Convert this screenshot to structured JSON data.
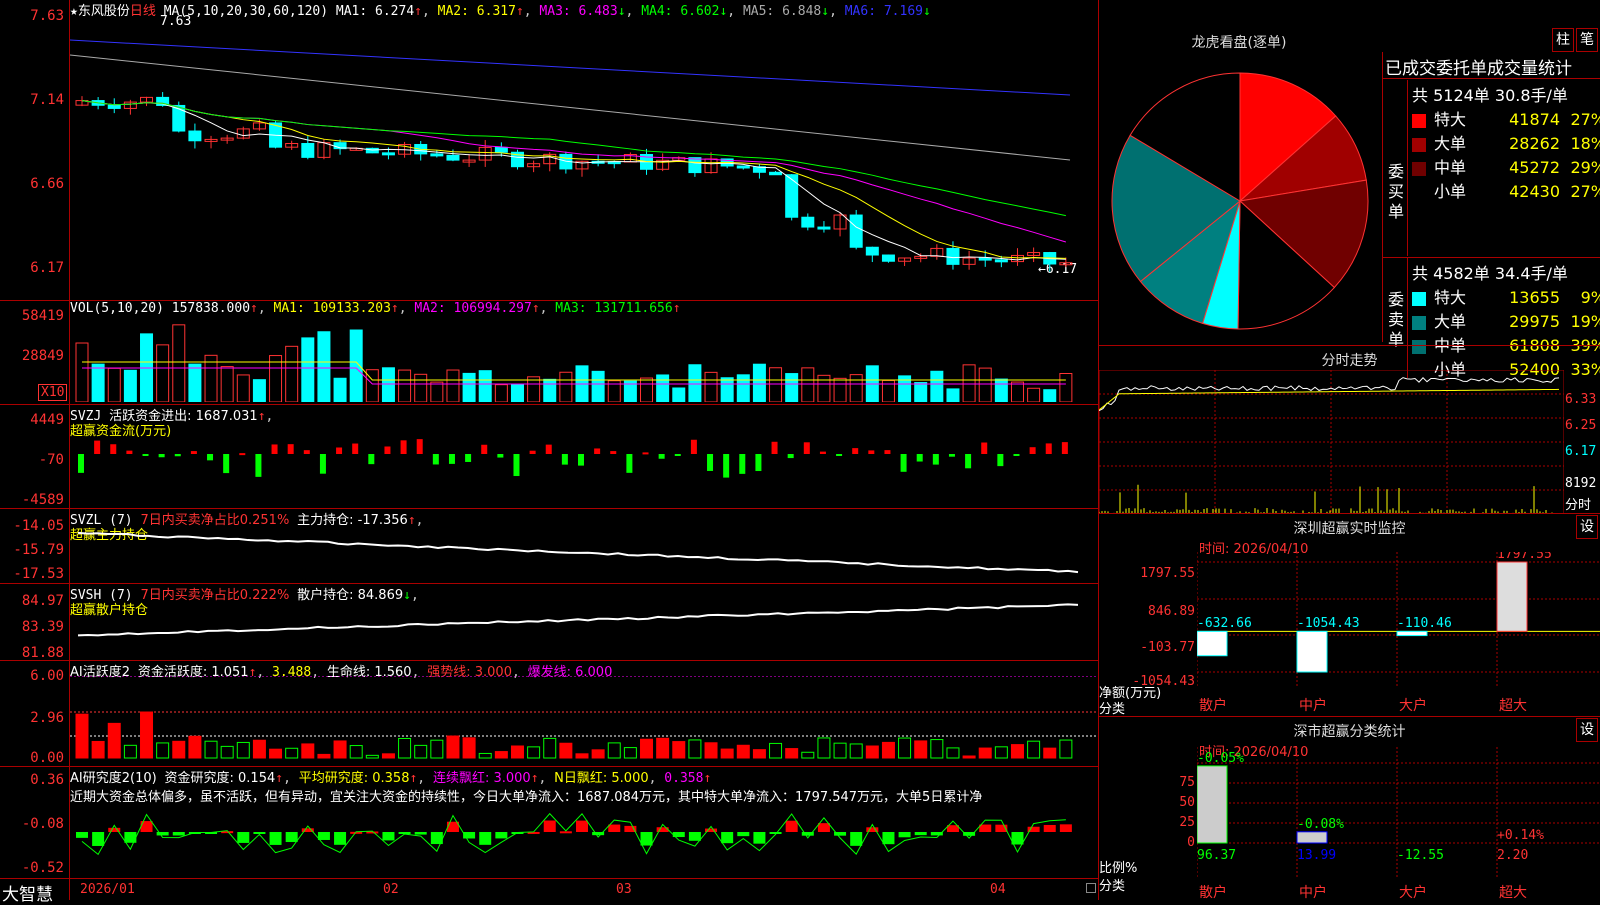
{
  "chart": {
    "title": "东风股份",
    "period": "日线",
    "ma_header": {
      "label": "MA(5,10,20,30,60,120)",
      "ma1": "MA1: 6.274",
      "ma2": "MA2: 6.317",
      "ma3": "MA3: 6.483",
      "ma4": "MA4: 6.602",
      "ma5": "MA5: 6.848",
      "ma6": "MA6: 7.169"
    },
    "y_labels": [
      "7.63",
      "7.14",
      "6.66",
      "6.17"
    ],
    "high_mark": "7.63",
    "low_mark": "←6.17",
    "colors": {
      "up": "#ff3333",
      "down": "#00ffff",
      "ma1": "#ffffff",
      "ma2": "#ffff00",
      "ma3": "#ff00ff",
      "ma4": "#00ff00",
      "ma5": "#aaaaaa",
      "ma6": "#3333ff"
    }
  },
  "vol": {
    "header": "VOL(5,10,20)",
    "value": "157838.000",
    "ma1": "MA1: 109133.203",
    "ma2": "MA2: 106994.297",
    "ma3": "MA3: 131711.656",
    "y_labels": [
      "58419",
      "28849"
    ],
    "unit": "X10"
  },
  "svzj": {
    "header": "SVZJ",
    "label": "活跃资金进出: 1687.031",
    "subtitle": "超赢资金流(万元)",
    "y_labels": [
      "4449",
      "-70",
      "-4589"
    ]
  },
  "svzl": {
    "header": "SVZL (7)",
    "label1": "7日内买卖净占比0.251%",
    "label2": "主力持仓: -17.356",
    "subtitle": "超赢主力持仓",
    "y_labels": [
      "-14.05",
      "-15.79",
      "-17.53"
    ]
  },
  "svsh": {
    "header": "SVSH (7)",
    "label1": "7日内买卖净占比0.222%",
    "label2": "散户持仓: 84.869",
    "subtitle": "超赢散户持仓",
    "y_labels": [
      "84.97",
      "83.39",
      "81.88"
    ]
  },
  "ai_active": {
    "header": "AI活跃度2",
    "a": "资金活跃度: 1.051",
    "b": "3.488",
    "c": "生命线: 1.560",
    "d": "强势线: 3.000",
    "e": "爆发线: 6.000",
    "y_labels": [
      "6.00",
      "2.96",
      "0.00"
    ]
  },
  "ai_research": {
    "header": "AI研究度2(10)",
    "a": "资金研究度: 0.154",
    "b": "平均研究度: 0.358",
    "c": "连续飘红: 3.000",
    "d": "N日飘红: 5.000",
    "e": "0.358",
    "comment": "近期大资金总体偏多，虽不活跃，但有异动，宜关注大资金的持续性，今日大单净流入：1687.084万元，其中特大单净流入：1797.547万元，大单5日累计净",
    "y_labels": [
      "0.36",
      "-0.08",
      "-0.52"
    ]
  },
  "xaxis": {
    "brand": "大智慧",
    "labels": [
      "2026/01",
      "02",
      "03",
      "04"
    ]
  },
  "dragon": {
    "title": "龙虎看盘(逐单)",
    "btn1": "柱",
    "btn2": "笔",
    "stat_title": "已成交委托单成交量统计",
    "buy_label": "委买单",
    "sell_label": "委卖单",
    "buy_total": "共 5124单 30.8手/单",
    "sell_total": "共 4582单 34.4手/单",
    "buy": [
      {
        "name": "特大",
        "vol": "41874",
        "pct": "27%",
        "value": 27,
        "color": "#ff0000"
      },
      {
        "name": "大单",
        "vol": "28262",
        "pct": "18%",
        "value": 18,
        "color": "#a00000"
      },
      {
        "name": "中单",
        "vol": "45272",
        "pct": "29%",
        "value": 29,
        "color": "#700000"
      },
      {
        "name": "小单",
        "vol": "42430",
        "pct": "27%",
        "value": 27,
        "color": "#000000"
      }
    ],
    "sell": [
      {
        "name": "特大",
        "vol": "13655",
        "pct": "9%",
        "value": 9,
        "color": "#00ffff"
      },
      {
        "name": "大单",
        "vol": "29975",
        "pct": "19%",
        "value": 19,
        "color": "#008080"
      },
      {
        "name": "中单",
        "vol": "61808",
        "pct": "39%",
        "value": 39,
        "color": "#007070"
      },
      {
        "name": "小单",
        "vol": "52400",
        "pct": "33%",
        "value": 33,
        "color": "#000000"
      }
    ]
  },
  "minute": {
    "title": "分时走势",
    "y_labels": [
      "6.33",
      "6.25",
      "6.17"
    ],
    "vol_label": "8192",
    "unit": "分时"
  },
  "sz_monitor": {
    "title": "深圳超赢实时监控",
    "btn": "设",
    "date": "时间: 2026/04/10",
    "y_labels": [
      "1797.55",
      "846.89",
      "-103.77",
      "-1054.43"
    ],
    "side_label1": "净额(万元)",
    "side_label2": "分类",
    "cats": [
      "散户",
      "中户",
      "大户",
      "超大"
    ],
    "values": [
      -632.66,
      -1054.43,
      -110.46,
      1797.55
    ],
    "value_labels": [
      "-632.66",
      "-1054.43",
      "-110.46",
      "1797.55"
    ],
    "ylim": [
      -1054.43,
      1797.55
    ]
  },
  "sz_class": {
    "title": "深市超赢分类统计",
    "btn": "设",
    "date": "时间: 2026/04/10",
    "y_labels": [
      "75",
      "50",
      "25",
      "0"
    ],
    "side_label1": "比例%",
    "side_label2": "分类",
    "cats": [
      "散户",
      "中户",
      "大户",
      "超大"
    ],
    "top_labels": [
      "-0.05%",
      "-0.08%",
      "",
      "+0.14%"
    ],
    "bottom_labels": [
      "96.37",
      "13.99",
      "-12.55",
      "2.20"
    ],
    "values": [
      96.37,
      13.99,
      0,
      0
    ]
  }
}
